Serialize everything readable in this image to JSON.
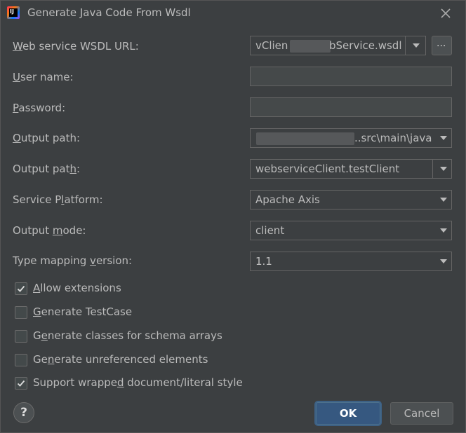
{
  "window": {
    "title": "Generate Java Code From Wsdl"
  },
  "fields": {
    "wsdl_url": {
      "label_pre": "",
      "label_mn": "W",
      "label_post": "eb service WSDL URL:",
      "value_a": "vClien",
      "value_b": "bService.wsdl",
      "browse_label": "..."
    },
    "user_name": {
      "label_pre": "",
      "label_mn": "U",
      "label_post": "ser name:",
      "value": ""
    },
    "password": {
      "label_pre": "",
      "label_mn": "P",
      "label_post": "assword:",
      "value": ""
    },
    "output_path": {
      "label_pre": "",
      "label_mn": "O",
      "label_post": "utput path:",
      "value": "..src\\main\\java"
    },
    "package": {
      "label_pre": "Output pat",
      "label_mn": "h",
      "label_post": ":",
      "value": "webserviceClient.testClient"
    },
    "platform": {
      "label_pre": "Service P",
      "label_mn": "l",
      "label_post": "atform:",
      "value": "Apache Axis"
    },
    "output_mode": {
      "label_pre": "Output ",
      "label_mn": "m",
      "label_post": "ode:",
      "value": "client"
    },
    "type_mapping": {
      "label_pre": "Type mapping ",
      "label_mn": "v",
      "label_post": "ersion:",
      "value": "1.1"
    }
  },
  "checkboxes": [
    {
      "pre": "",
      "mn": "A",
      "post": "llow extensions",
      "checked": true
    },
    {
      "pre": "",
      "mn": "G",
      "post": "enerate TestCase",
      "checked": false
    },
    {
      "pre": "G",
      "mn": "e",
      "post": "nerate classes for schema arrays",
      "checked": false
    },
    {
      "pre": "Ge",
      "mn": "n",
      "post": "erate unreferenced elements",
      "checked": false
    },
    {
      "pre": "Support wrappe",
      "mn": "d",
      "post": " document/literal style",
      "checked": true
    }
  ],
  "buttons": {
    "ok": "OK",
    "cancel": "Cancel",
    "help": "?"
  },
  "colors": {
    "background": "#3c3f41",
    "primary_button": "#365880",
    "text": "#bbbbbb"
  }
}
